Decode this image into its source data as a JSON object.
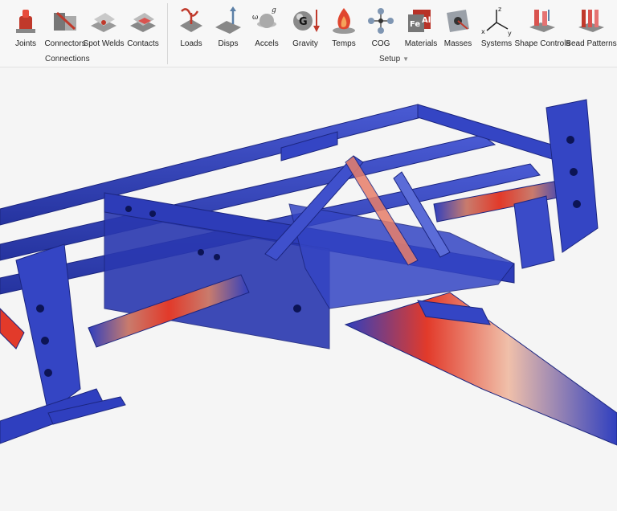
{
  "ribbon": {
    "connections": {
      "group_label": "Connections",
      "tools": [
        {
          "label": "Joints",
          "icon": "joints-icon"
        },
        {
          "label": "Connectors",
          "icon": "connectors-icon"
        },
        {
          "label": "Spot Welds",
          "icon": "spot-welds-icon"
        },
        {
          "label": "Contacts",
          "icon": "contacts-icon"
        }
      ]
    },
    "setup": {
      "group_label": "Setup",
      "caret": "▼",
      "tools": [
        {
          "label": "Loads",
          "icon": "loads-icon"
        },
        {
          "label": "Disps",
          "icon": "disps-icon"
        },
        {
          "label": "Accels",
          "icon": "accels-icon"
        },
        {
          "label": "Gravity",
          "icon": "gravity-icon"
        },
        {
          "label": "Temps",
          "icon": "temps-icon"
        },
        {
          "label": "COG",
          "icon": "cog-icon"
        },
        {
          "label": "Materials",
          "icon": "materials-icon"
        },
        {
          "label": "Masses",
          "icon": "masses-icon"
        },
        {
          "label": "Systems",
          "icon": "systems-icon"
        },
        {
          "label": "Shape Controls",
          "icon": "shape-controls-icon"
        },
        {
          "label": "Bead Patterns",
          "icon": "bead-patterns-icon"
        }
      ]
    },
    "icon_text": {
      "accels_omega": "ω",
      "accels_g": "g",
      "gravity_g": "G",
      "materials_fe": "Fe",
      "materials_al": "Al",
      "systems_x": "x",
      "systems_y": "y",
      "systems_z": "z"
    }
  },
  "colors": {
    "mesh_blue": "#2f3fbf",
    "stress_high": "#e23a2a",
    "stress_mid": "#f2c9b0",
    "ribbon_bg": "#f7f7f7"
  }
}
